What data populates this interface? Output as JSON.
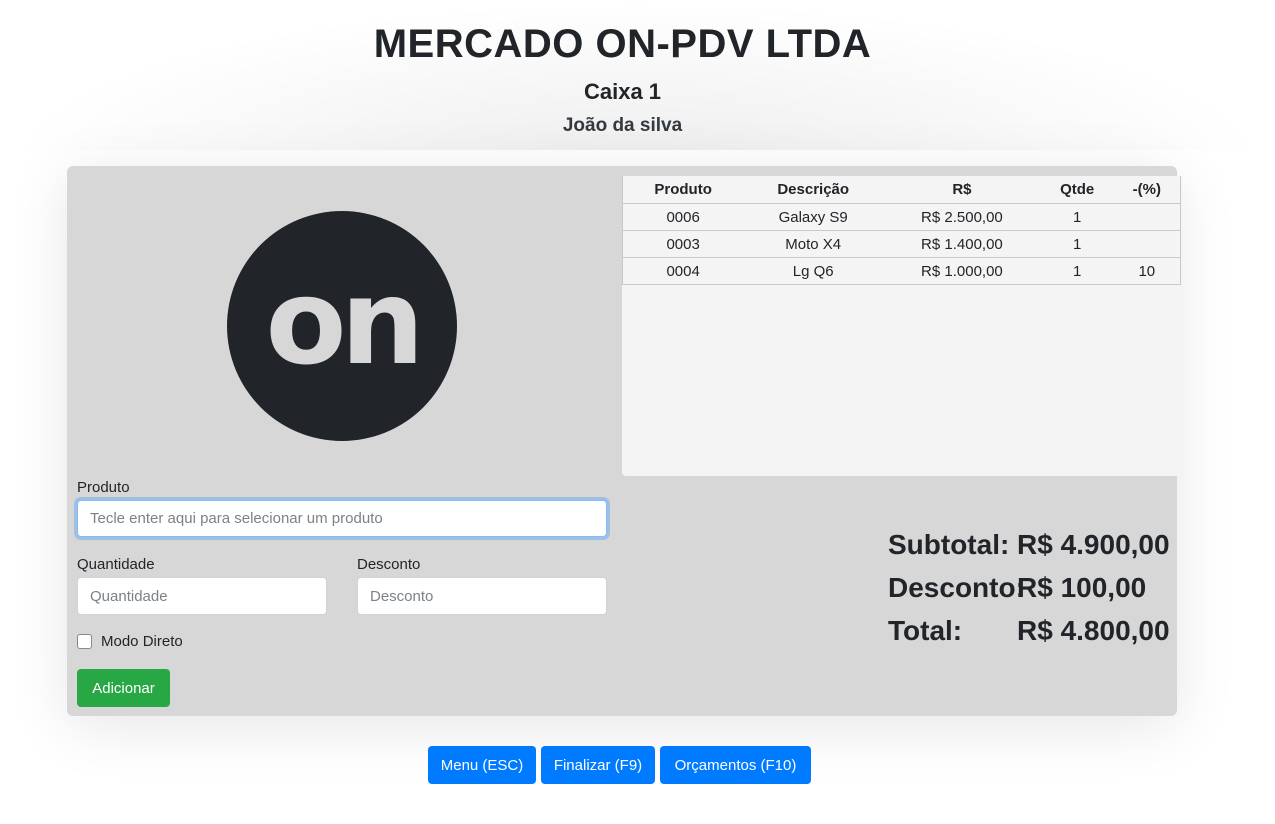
{
  "header": {
    "company": "MERCADO ON-PDV LTDA",
    "register": "Caixa 1",
    "operator": "João da silva"
  },
  "logo": {
    "text": "on"
  },
  "cart": {
    "columns": [
      "Produto",
      "Descrição",
      "R$",
      "Qtde",
      "-(%)"
    ],
    "rows": [
      [
        "0006",
        "Galaxy S9",
        "R$ 2.500,00",
        "1",
        ""
      ],
      [
        "0003",
        "Moto X4",
        "R$ 1.400,00",
        "1",
        ""
      ],
      [
        "0004",
        "Lg Q6",
        "R$ 1.000,00",
        "1",
        "10"
      ]
    ]
  },
  "form": {
    "product_label": "Produto",
    "product_placeholder": "Tecle enter aqui para selecionar um produto",
    "quantity_label": "Quantidade",
    "quantity_placeholder": "Quantidade",
    "discount_label": "Desconto",
    "discount_placeholder": "Desconto",
    "direct_mode_label": "Modo Direto",
    "add_button": "Adicionar"
  },
  "totals": {
    "subtotal_label": "Subtotal:",
    "subtotal_value": "R$ 4.900,00",
    "discount_label": "Desconto:",
    "discount_value": "R$ 100,00",
    "total_label": "Total:",
    "total_value": "R$ 4.800,00"
  },
  "actions": {
    "menu": "Menu (ESC)",
    "finish": "Finalizar (F9)",
    "quotes": "Orçamentos (F10)"
  },
  "colors": {
    "primary": "#007bff",
    "success": "#28a745",
    "panel": "#d7d7d7",
    "dark": "#212529"
  }
}
